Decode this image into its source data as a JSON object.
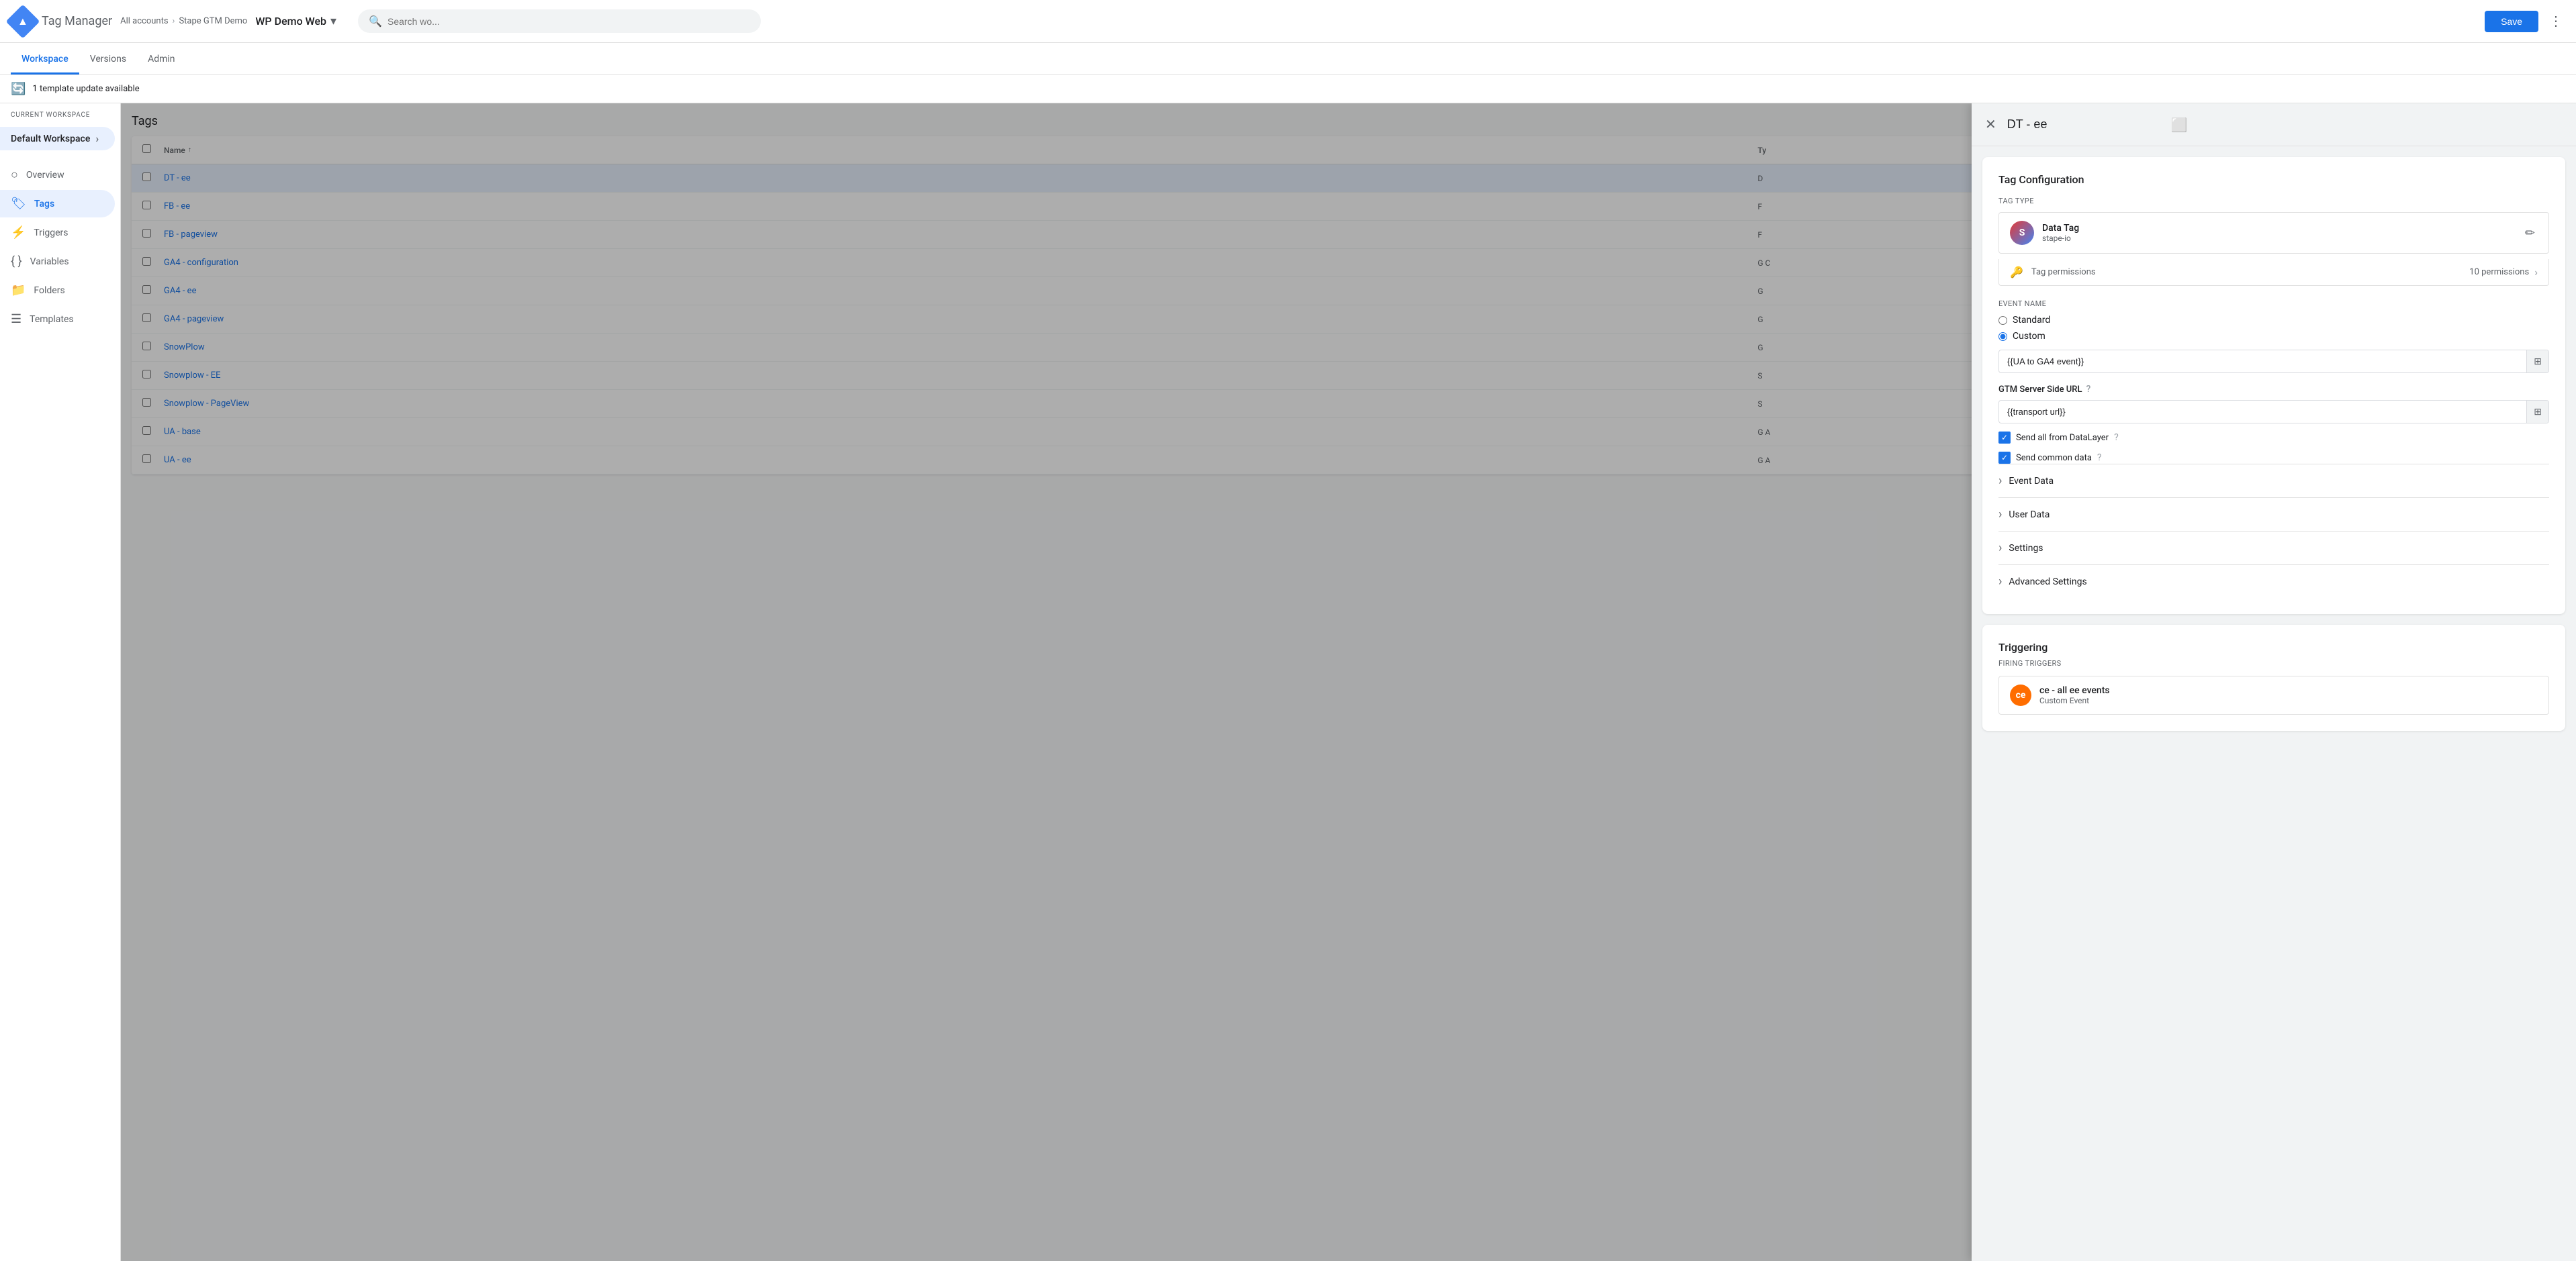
{
  "app": {
    "name": "Tag Manager",
    "logo_letter": "▲"
  },
  "breadcrumb": {
    "all_accounts": "All accounts",
    "separator": "›",
    "account": "Stape GTM Demo"
  },
  "workspace_selector": {
    "label": "WP Demo Web",
    "chevron": "▾"
  },
  "search": {
    "placeholder": "Search wo..."
  },
  "topbar": {
    "save_label": "Save",
    "more_icon": "⋮"
  },
  "tabs": [
    {
      "id": "workspace",
      "label": "Workspace",
      "active": true
    },
    {
      "id": "versions",
      "label": "Versions",
      "active": false
    },
    {
      "id": "admin",
      "label": "Admin",
      "active": false
    }
  ],
  "banner": {
    "text": "1 template update available"
  },
  "sidebar": {
    "workspace_label": "CURRENT WORKSPACE",
    "workspace_name": "Default Workspace",
    "nav_items": [
      {
        "id": "overview",
        "label": "Overview",
        "icon": "○"
      },
      {
        "id": "tags",
        "label": "Tags",
        "icon": "🏷",
        "active": true
      },
      {
        "id": "triggers",
        "label": "Triggers",
        "icon": "⚡"
      },
      {
        "id": "variables",
        "label": "Variables",
        "icon": "{ }"
      },
      {
        "id": "folders",
        "label": "Folders",
        "icon": "📁"
      },
      {
        "id": "templates",
        "label": "Templates",
        "icon": "☰"
      }
    ]
  },
  "tags_table": {
    "title": "Tags",
    "columns": [
      "Name",
      "Ty"
    ],
    "rows": [
      {
        "name": "DT - ee",
        "type": "D",
        "active": true
      },
      {
        "name": "FB - ee",
        "type": "F"
      },
      {
        "name": "FB - pageview",
        "type": "F"
      },
      {
        "name": "GA4 - configuration",
        "type": "G\nC"
      },
      {
        "name": "GA4 - ee",
        "type": "G"
      },
      {
        "name": "GA4 - pageview",
        "type": "G"
      },
      {
        "name": "SnowPlow",
        "type": "G"
      },
      {
        "name": "Snowplow - EE",
        "type": "S"
      },
      {
        "name": "Snowplow - PageView",
        "type": "S"
      },
      {
        "name": "UA - base",
        "type": "G\nA"
      },
      {
        "name": "UA - ee",
        "type": "G\nA"
      }
    ]
  },
  "modal": {
    "tag_name": "DT - ee",
    "close_icon": "✕",
    "folder_icon": "⬜",
    "tag_configuration": {
      "title": "Tag Configuration",
      "tag_type_label": "Tag Type",
      "tag_type": {
        "logo": "S",
        "name": "Data Tag",
        "sub": "stape-io",
        "edit_icon": "✏"
      },
      "permissions": {
        "key_icon": "🔑",
        "label": "Tag permissions",
        "count": "10 permissions",
        "arrow": "›"
      },
      "event_name_label": "Event Name",
      "radio_standard": "Standard",
      "radio_custom": "Custom",
      "event_name_value": "{{UA to GA4 event}}",
      "event_name_placeholder": "{{UA to GA4 event}}",
      "gtm_url_label": "GTM Server Side URL",
      "gtm_url_help": "?",
      "gtm_url_value": "{{transport url}}",
      "send_datalayer": "Send all from DataLayer",
      "send_datalayer_help": "?",
      "send_common": "Send common data",
      "send_common_help": "?",
      "sections": [
        {
          "label": "Event Data"
        },
        {
          "label": "User Data"
        },
        {
          "label": "Settings"
        },
        {
          "label": "Advanced Settings"
        }
      ]
    },
    "triggering": {
      "title": "Triggering",
      "firing_label": "Firing Triggers",
      "trigger": {
        "icon": "ce",
        "name": "ce - all ee events",
        "type": "Custom Event"
      }
    }
  }
}
